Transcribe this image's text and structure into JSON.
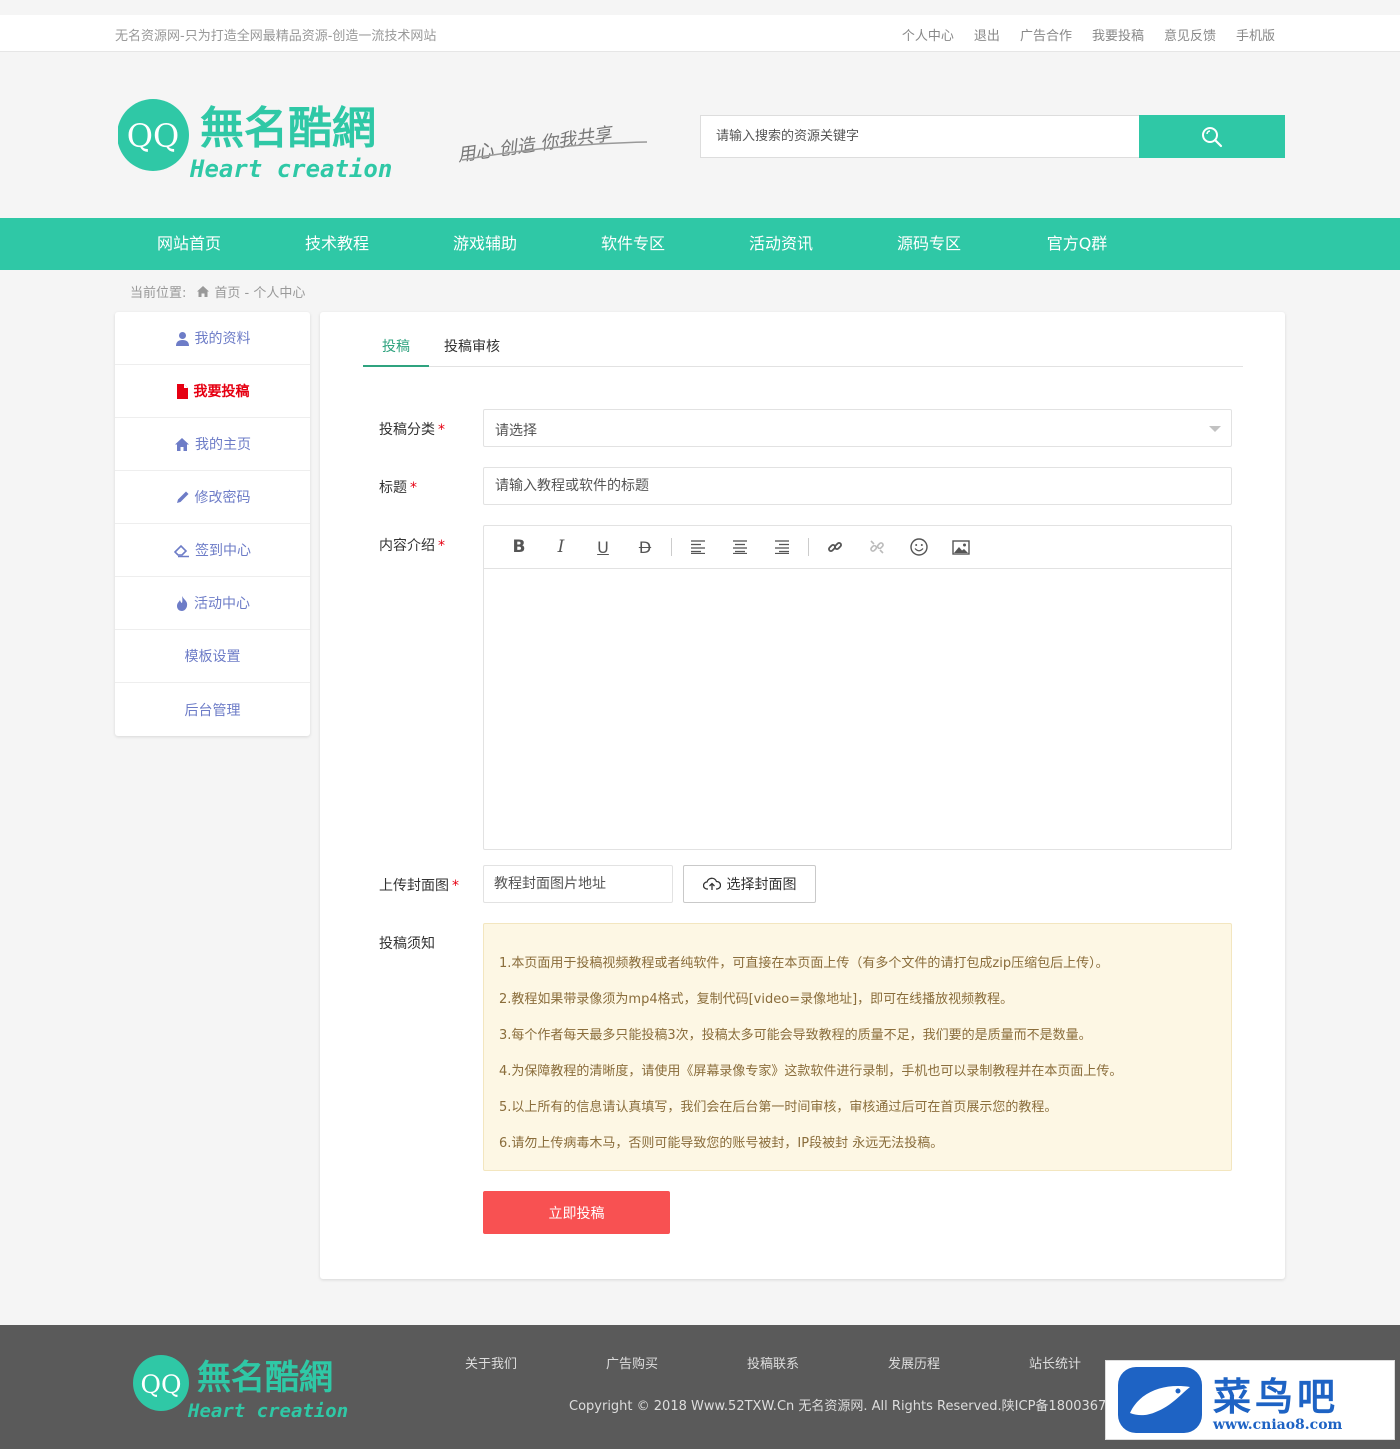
{
  "topbar": {
    "slogan": "无名资源网-只为打造全网最精品资源-创造一流技术网站",
    "links": [
      "个人中心",
      "退出",
      "广告合作",
      "我要投稿",
      "意见反馈",
      "手机版"
    ]
  },
  "logo": {
    "mark": "QQ",
    "title": "無名酷網",
    "subtitle": "Heart creation",
    "tagline": "用心 创造 你我共享"
  },
  "search": {
    "placeholder": "请输入搜索的资源关键字"
  },
  "nav": [
    "网站首页",
    "技术教程",
    "游戏辅助",
    "软件专区",
    "活动资讯",
    "源码专区",
    "官方Q群"
  ],
  "breadcrumb": {
    "prefix": "当前位置:",
    "path": "首页 - 个人中心"
  },
  "sidebar": [
    {
      "label": "我的资料",
      "icon": "user-icon"
    },
    {
      "label": "我要投稿",
      "icon": "file-icon",
      "active": true
    },
    {
      "label": "我的主页",
      "icon": "home-icon"
    },
    {
      "label": "修改密码",
      "icon": "pencil-icon"
    },
    {
      "label": "签到中心",
      "icon": "eraser-icon"
    },
    {
      "label": "活动中心",
      "icon": "fire-icon"
    },
    {
      "label": "模板设置"
    },
    {
      "label": "后台管理"
    }
  ],
  "tabs": [
    "投稿",
    "投稿审核"
  ],
  "form": {
    "category_label": "投稿分类",
    "category_value": "请选择",
    "title_label": "标题",
    "title_placeholder": "请输入教程或软件的标题",
    "content_label": "内容介绍",
    "cover_label": "上传封面图",
    "cover_placeholder": "教程封面图片地址",
    "cover_button": "选择封面图",
    "notice_label": "投稿须知",
    "required_mark": "*",
    "submit": "立即投稿"
  },
  "notice": [
    "1.本页面用于投稿视频教程或者纯软件，可直接在本页面上传（有多个文件的请打包成zip压缩包后上传）。",
    "2.教程如果带录像须为mp4格式，复制代码[video=录像地址]，即可在线播放视频教程。",
    "3.每个作者每天最多只能投稿3次，投稿太多可能会导致教程的质量不足，我们要的是质量而不是数量。",
    "4.为保障教程的清晰度，请使用《屏幕录像专家》这款软件进行录制，手机也可以录制教程并在本页面上传。",
    "5.以上所有的信息请认真填写，我们会在后台第一时间审核，审核通过后可在首页展示您的教程。",
    "6.请勿上传病毒木马，否则可能导致您的账号被封，IP段被封 永远无法投稿。"
  ],
  "footer": {
    "links": [
      "关于我们",
      "广告购买",
      "投稿联系",
      "发展历程",
      "站长统计"
    ],
    "copyright": "Copyright © 2018 Www.52TXW.Cn 无名资源网. All Rights Reserved.陕ICP备18003672"
  },
  "watermark": {
    "text": "菜鸟吧",
    "url": "www.cniao8.com"
  },
  "colors": {
    "accent": "#2fc8a6",
    "submit": "#f85152",
    "notice_bg": "#fdf7e4",
    "active": "#e60012",
    "sidebar": "#6d7cc7"
  }
}
